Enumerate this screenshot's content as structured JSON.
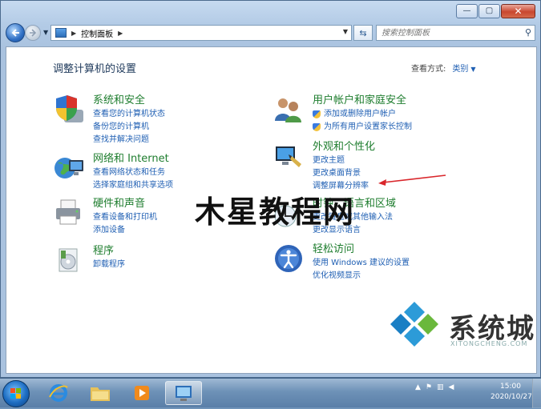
{
  "window": {
    "min_glyph": "—",
    "max_glyph": "▢",
    "close_glyph": "✕"
  },
  "nav": {
    "breadcrumb": "控制面板",
    "search_placeholder": "搜索控制面板"
  },
  "content": {
    "title": "调整计算机的设置",
    "view_by_label": "查看方式:",
    "view_by_value": "类别"
  },
  "categories": {
    "system": {
      "title": "系统和安全",
      "links": [
        "查看您的计算机状态",
        "备份您的计算机",
        "查找并解决问题"
      ]
    },
    "network": {
      "title": "网络和 Internet",
      "links": [
        "查看网络状态和任务",
        "选择家庭组和共享选项"
      ]
    },
    "hardware": {
      "title": "硬件和声音",
      "links": [
        "查看设备和打印机",
        "添加设备"
      ]
    },
    "programs": {
      "title": "程序",
      "links": [
        "卸载程序"
      ]
    },
    "users": {
      "title": "用户帐户和家庭安全",
      "links": [
        "添加或删除用户帐户",
        "为所有用户设置家长控制"
      ]
    },
    "appearance": {
      "title": "外观和个性化",
      "links": [
        "更改主题",
        "更改桌面背景",
        "调整屏幕分辨率"
      ]
    },
    "clock": {
      "title": "时钟、语言和区域",
      "links": [
        "更改键盘或其他输入法",
        "更改显示语言"
      ]
    },
    "ease": {
      "title": "轻松访问",
      "links": [
        "使用 Windows 建议的设置",
        "优化视频显示"
      ]
    }
  },
  "overlay": {
    "watermark": "木星教程网",
    "logo_text": "系统城",
    "logo_sub": "XITONGCHENG.COM"
  },
  "taskbar": {
    "time": "15:00",
    "date": "2020/10/27"
  },
  "colors": {
    "link": "#1f5fb3",
    "category_title": "#1e7d2e",
    "page_title": "#1e395b",
    "annotation_arrow": "#d9262b"
  }
}
